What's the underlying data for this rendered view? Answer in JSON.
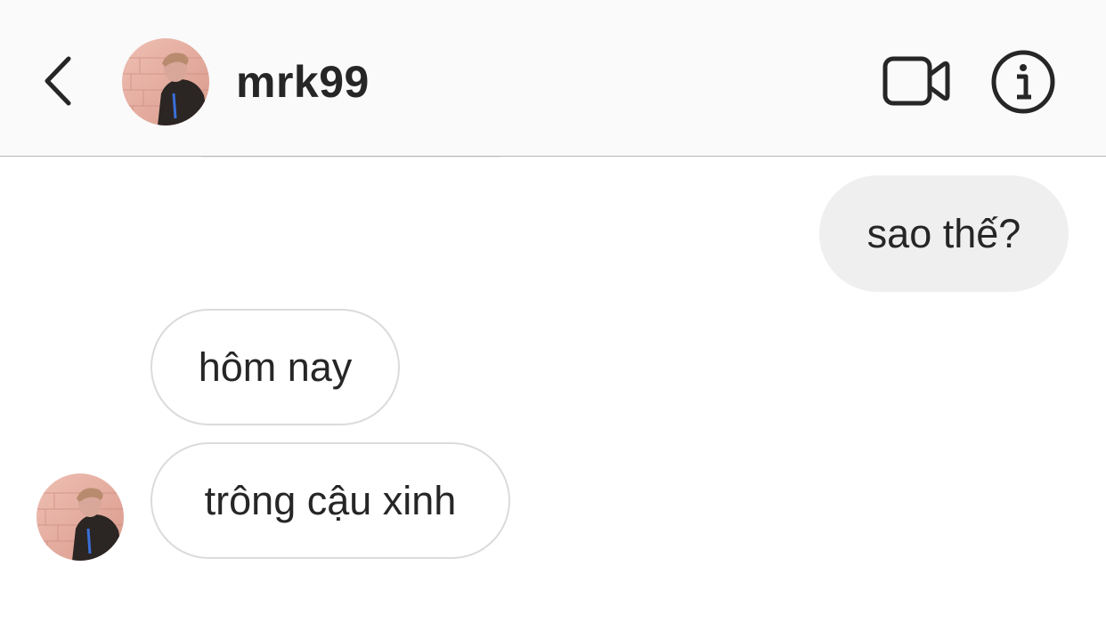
{
  "header": {
    "back_icon": "chevron-left-icon",
    "avatar_icon": "profile-photo",
    "username": "mrk99",
    "video_icon": "video-camera-icon",
    "info_icon": "info-circle-icon"
  },
  "messages": [
    {
      "direction": "outgoing",
      "text": "sao thế?"
    },
    {
      "direction": "incoming",
      "text": "hôm nay"
    },
    {
      "direction": "incoming",
      "text": "trông cậu xinh"
    }
  ],
  "colors": {
    "header_bg": "#fafafa",
    "divider": "#b8b8b8",
    "text": "#262626",
    "outgoing_bubble": "#efefef",
    "incoming_border": "#dbdbdb",
    "avatar_bg": "#e9b2a6"
  }
}
